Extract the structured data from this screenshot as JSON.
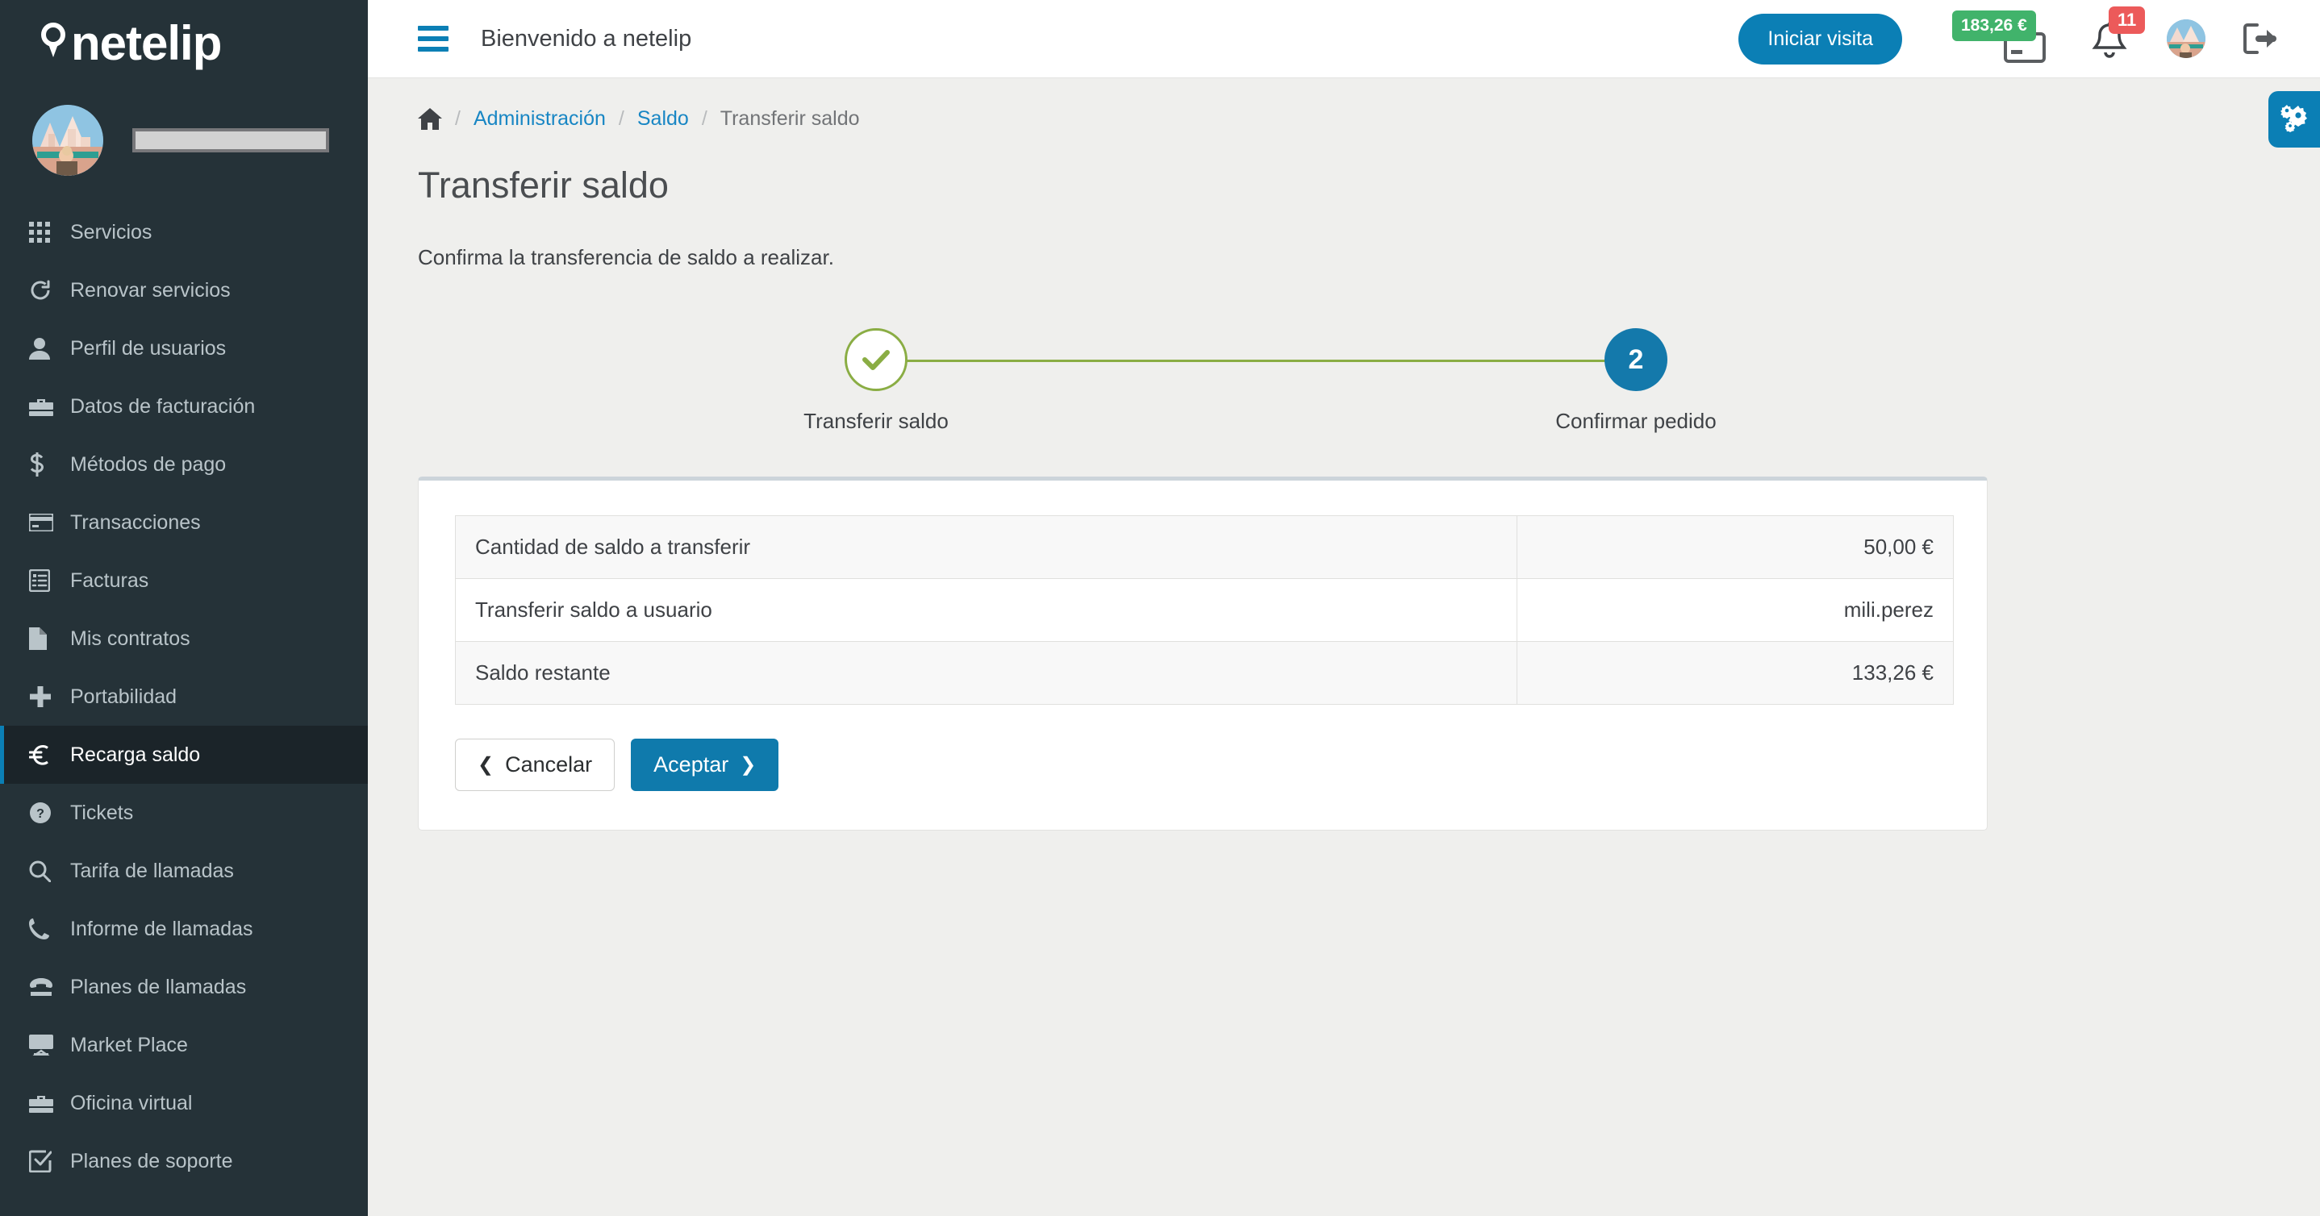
{
  "brand": {
    "name": "netelip",
    "pin_icon": "location-pin-icon"
  },
  "sidebar": {
    "username_redacted": "",
    "items": [
      {
        "label": "Servicios",
        "icon": "grid-icon",
        "active": false
      },
      {
        "label": "Renovar servicios",
        "icon": "refresh-icon",
        "active": false
      },
      {
        "label": "Perfil de usuarios",
        "icon": "user-icon",
        "active": false
      },
      {
        "label": "Datos de facturación",
        "icon": "briefcase-icon",
        "active": false
      },
      {
        "label": "Métodos de pago",
        "icon": "dollar-icon",
        "active": false
      },
      {
        "label": "Transacciones",
        "icon": "credit-card-icon",
        "active": false
      },
      {
        "label": "Facturas",
        "icon": "invoice-list-icon",
        "active": false
      },
      {
        "label": "Mis contratos",
        "icon": "document-icon",
        "active": false
      },
      {
        "label": "Portabilidad",
        "icon": "plus-icon",
        "active": false
      },
      {
        "label": "Recarga saldo",
        "icon": "euro-icon",
        "active": true
      },
      {
        "label": "Tickets",
        "icon": "question-circle-icon",
        "active": false
      },
      {
        "label": "Tarifa de llamadas",
        "icon": "search-icon",
        "active": false
      },
      {
        "label": "Informe de llamadas",
        "icon": "phone-icon",
        "active": false
      },
      {
        "label": "Planes de llamadas",
        "icon": "telephone-icon",
        "active": false
      },
      {
        "label": "Market Place",
        "icon": "desktop-icon",
        "active": false
      },
      {
        "label": "Oficina virtual",
        "icon": "briefcase-icon",
        "active": false
      },
      {
        "label": "Planes de soporte",
        "icon": "check-square-icon",
        "active": false
      }
    ]
  },
  "topbar": {
    "menu_icon": "hamburger-icon",
    "title": "Bienvenido a netelip",
    "visit_button": "Iniciar visita",
    "balance": "183,26 €",
    "balance_icon": "credit-card-icon",
    "notifications_count": "11",
    "bell_icon": "bell-icon",
    "avatar_icon": "user-avatar",
    "logout_icon": "logout-icon"
  },
  "settings_tab": {
    "icon": "cogs-icon"
  },
  "breadcrumb": {
    "home_icon": "home-icon",
    "separator": "/",
    "items": [
      {
        "label": "Administración",
        "link": true
      },
      {
        "label": "Saldo",
        "link": true
      },
      {
        "label": "Transferir saldo",
        "link": false
      }
    ]
  },
  "page": {
    "title": "Transferir saldo",
    "subtitle": "Confirma la transferencia de saldo a realizar."
  },
  "stepper": {
    "steps": [
      {
        "number": "1",
        "label": "Transferir saldo",
        "state": "done",
        "marker": "✔"
      },
      {
        "number": "2",
        "label": "Confirmar pedido",
        "state": "current",
        "marker": "2"
      }
    ]
  },
  "summary": {
    "rows": [
      {
        "label": "Cantidad de saldo a transferir",
        "value": "50,00 €"
      },
      {
        "label": "Transferir saldo a usuario",
        "value": "mili.perez"
      },
      {
        "label": "Saldo restante",
        "value": "133,26 €"
      }
    ]
  },
  "actions": {
    "cancel_label": "Cancelar",
    "accept_label": "Aceptar",
    "cancel_chevron": "❮",
    "accept_chevron": "❯"
  },
  "colors": {
    "sidebar_bg": "#253238",
    "sidebar_active_bg": "#1b2429",
    "accent_blue": "#0b7fb5",
    "link_blue": "#1886c4",
    "green_badge": "#41b36b",
    "red_badge": "#ec5a5a",
    "step_green": "#8aad44",
    "step_blue": "#1479ab"
  }
}
